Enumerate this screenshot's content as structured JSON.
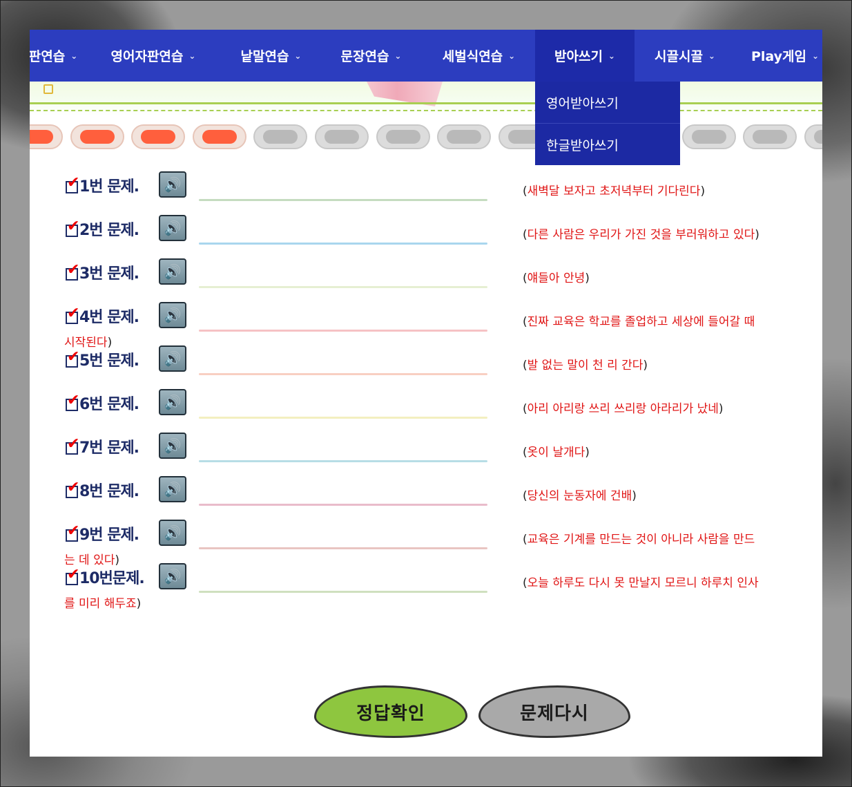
{
  "nav": {
    "items": [
      {
        "label": "판연습"
      },
      {
        "label": "영어자판연습"
      },
      {
        "label": "낱말연습"
      },
      {
        "label": "문장연습"
      },
      {
        "label": "세벌식연습"
      },
      {
        "label": "받아쓰기"
      },
      {
        "label": "시끌시끌"
      },
      {
        "label": "Play게임"
      }
    ],
    "active": "받아쓰기",
    "dropdown": [
      "영어받아쓰기",
      "한글받아쓰기"
    ]
  },
  "progress": {
    "completed": 4,
    "total": 14
  },
  "questions": [
    {
      "label": "1번 문제.",
      "hint": "새벽달 보자고 초저녁부터 기다린다",
      "color": "#c5dcc0"
    },
    {
      "label": "2번 문제.",
      "hint": "다른 사람은 우리가 가진 것을 부러워하고 있다",
      "color": "#a9d6ee"
    },
    {
      "label": "3번 문제.",
      "hint": "얘들아 안녕",
      "color": "#e6efd2"
    },
    {
      "label": "4번 문제.",
      "hint": "진짜 교육은 학교를 졸업하고 세상에 들어갈 때",
      "wrap": "시작된다",
      "color": "#f6c2c4"
    },
    {
      "label": "5번 문제.",
      "hint": "발 없는 말이 천 리 간다",
      "color": "#f8cfc2"
    },
    {
      "label": "6번 문제.",
      "hint": "아리 아리랑 쓰리 쓰리랑 아라리가 났네",
      "color": "#f3efbf"
    },
    {
      "label": "7번 문제.",
      "hint": "옷이 날개다",
      "color": "#b7dde6"
    },
    {
      "label": "8번 문제.",
      "hint": "당신의 눈동자에 건배",
      "color": "#e9bccb"
    },
    {
      "label": "9번 문제.",
      "hint": "교육은 기계를 만드는 것이 아니라 사람을 만드",
      "wrap": "는 데 있다",
      "color": "#e9c5c2"
    },
    {
      "label": "10번문제.",
      "hint": "오늘 하루도 다시 못 만날지 모르니 하루치 인사",
      "wrap": "를 미리 해두죠",
      "color": "#cfe0bf"
    }
  ],
  "buttons": {
    "check": "정답확인",
    "retry": "문제다시"
  }
}
